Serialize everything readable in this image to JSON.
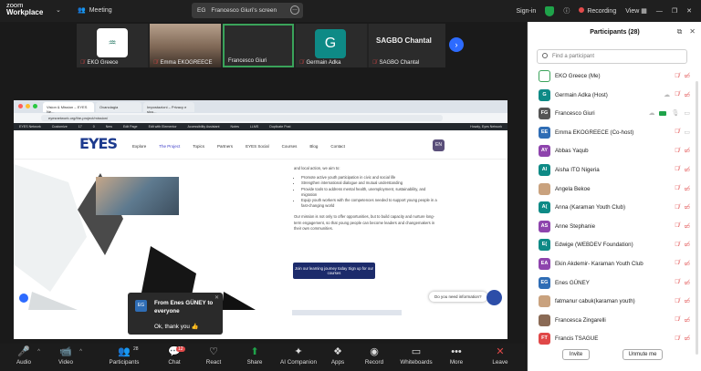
{
  "app": {
    "brand_line1": "zoom",
    "brand_line2": "Workplace",
    "meeting_label": "Meeting"
  },
  "screen_tab": {
    "initials": "EG",
    "title": "Francesco Giuri's screen"
  },
  "top_right": {
    "signin": "Sign-in",
    "recording": "Recording",
    "view": "View"
  },
  "gallery": [
    {
      "name": "EKO Greece",
      "type": "logo"
    },
    {
      "name": "Emma EKOGREECE",
      "type": "video"
    },
    {
      "name": "Francesco Giuri",
      "type": "blank"
    },
    {
      "name": "Germain Adka",
      "type": "letter",
      "letter": "G"
    },
    {
      "name": "SAGBO Chantal",
      "type": "name"
    }
  ],
  "shared": {
    "url": "eyesnetwork.org/the-project/mission/",
    "bookmarks": [
      "EYES Network",
      "Customize",
      "17",
      "0",
      "New",
      "Edit Page",
      "Edit with Elementor",
      "Accessibility Assistant",
      "Notes",
      "LLMS",
      "Duplicate Post",
      "Howdy, Eyes Network"
    ],
    "logo_text": "EYES",
    "nav": [
      "Explore",
      "The Project",
      "Topics",
      "Partners",
      "EYES Social",
      "Courses",
      "Blog",
      "Contact"
    ],
    "lang": "EN",
    "lead": "and local action, we aim to:",
    "bullets": [
      "Promote active youth participation in civic and social life",
      "Strengthen international dialogue and mutual understanding",
      "Provide tools to address mental health, unemployment, sustainability, and migration",
      "Equip youth workers with the competences needed to support young people in a fast-changing world"
    ],
    "paragraph": "Our mission is not only to offer opportunities, but to build capacity and nurture long-term engagement, so that young people can become leaders and changemakers in their own communities.",
    "cta": "Join our learning journey today Sign up for our courses",
    "need_info": "Do you need information?"
  },
  "toast": {
    "initials": "EG",
    "from": "From Enes GÜNEY to everyone",
    "message": "Ok, thank you 👍"
  },
  "toolbar": [
    {
      "label": "Audio",
      "icon": "🎤"
    },
    {
      "label": "Video",
      "icon": "📹"
    },
    {
      "label": "Participants",
      "icon": "👥",
      "count": "28"
    },
    {
      "label": "Chat",
      "icon": "💬",
      "badge": "12"
    },
    {
      "label": "React",
      "icon": "♡"
    },
    {
      "label": "Share",
      "icon": "⬆"
    },
    {
      "label": "AI Companion",
      "icon": "✦"
    },
    {
      "label": "Apps",
      "icon": "❖"
    },
    {
      "label": "Record",
      "icon": "●"
    },
    {
      "label": "Whiteboards",
      "icon": "▭"
    },
    {
      "label": "More",
      "icon": "•••"
    },
    {
      "label": "Leave",
      "icon": "✕"
    }
  ],
  "panel": {
    "title": "Participants (28)",
    "search_placeholder": "Find a participant",
    "invite": "Invite",
    "unmute": "Unmute me",
    "participants": [
      {
        "name": "EKO Greece (Me)",
        "initials": "",
        "color": "#ffffff"
      },
      {
        "name": "Germain Adka (Host)",
        "initials": "G",
        "color": "#0e8a86"
      },
      {
        "name": "Francesco Giuri",
        "initials": "FG",
        "color": "#555555"
      },
      {
        "name": "Emma EKOGREECE (Co-host)",
        "initials": "EE",
        "color": "#2f6db5"
      },
      {
        "name": "Abbas Yaqub",
        "initials": "AY",
        "color": "#8e44ad"
      },
      {
        "name": "Aisha ITO Nigeria",
        "initials": "AI",
        "color": "#0e8a86"
      },
      {
        "name": "Angela Bekoe",
        "initials": "",
        "color": "#c9a27e"
      },
      {
        "name": "Anna (Karaman Youth Club)",
        "initials": "A(",
        "color": "#0e8a86"
      },
      {
        "name": "Anne Stephanie",
        "initials": "AS",
        "color": "#8e44ad"
      },
      {
        "name": "Edwige (WEBDEV Foundation)",
        "initials": "E(",
        "color": "#0e8a86"
      },
      {
        "name": "Ekin Akdemir- Karaman Youth Club",
        "initials": "EA",
        "color": "#8e44ad"
      },
      {
        "name": "Enes GÜNEY",
        "initials": "EG",
        "color": "#2f6db5"
      },
      {
        "name": "fatmanur cabuk(karaman youth)",
        "initials": "",
        "color": "#c9a27e"
      },
      {
        "name": "Francesca Zingarelli",
        "initials": "",
        "color": "#8a6a55"
      },
      {
        "name": "Francis TSAGUE",
        "initials": "FT",
        "color": "#e04848"
      }
    ]
  }
}
